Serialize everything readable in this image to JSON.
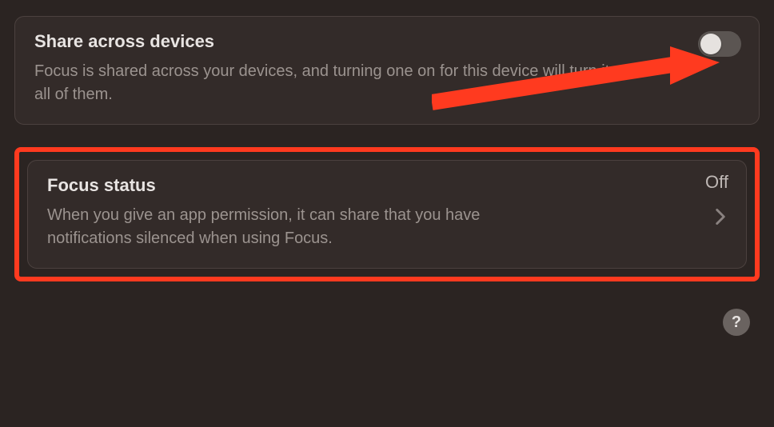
{
  "share_panel": {
    "title": "Share across devices",
    "description": "Focus is shared across your devices, and turning one on for this device will turn it on for all of them.",
    "toggle_on": false
  },
  "focus_panel": {
    "title": "Focus status",
    "description": "When you give an app permission, it can share that you have notifications silenced when using Focus.",
    "value": "Off"
  },
  "help_label": "?",
  "annotation": {
    "arrow_color": "#ff3a1f",
    "highlight_color": "#ff3a1f"
  }
}
